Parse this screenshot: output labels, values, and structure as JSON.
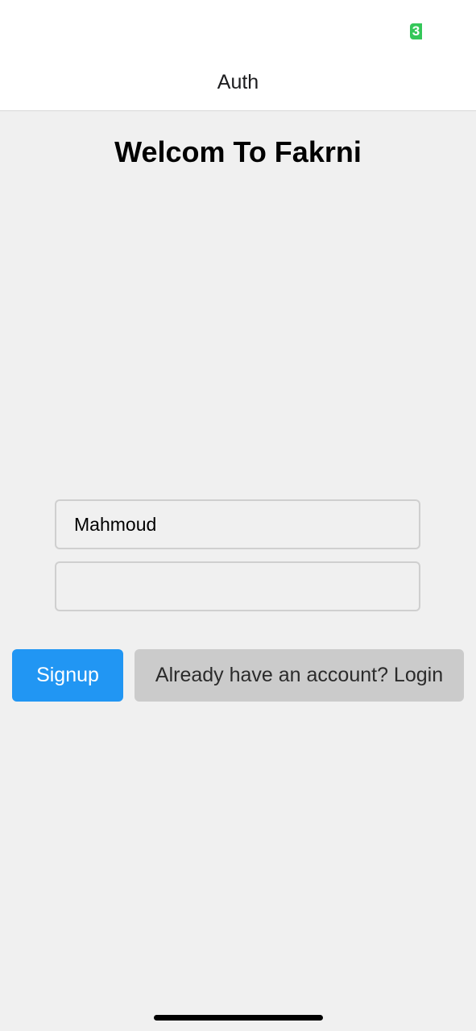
{
  "status_bar": {
    "battery_text": "3",
    "battery_color": "#34c759"
  },
  "header": {
    "title": "Auth"
  },
  "main": {
    "heading": "Welcom To Fakrni",
    "username_field": {
      "value": "Mahmoud"
    },
    "second_field": {
      "value": ""
    },
    "signup_label": "Signup",
    "login_label": "Already have an account? Login"
  },
  "colors": {
    "primary": "#2196f3",
    "secondary_button": "#cbcbcb",
    "background": "#f0f0f0"
  }
}
